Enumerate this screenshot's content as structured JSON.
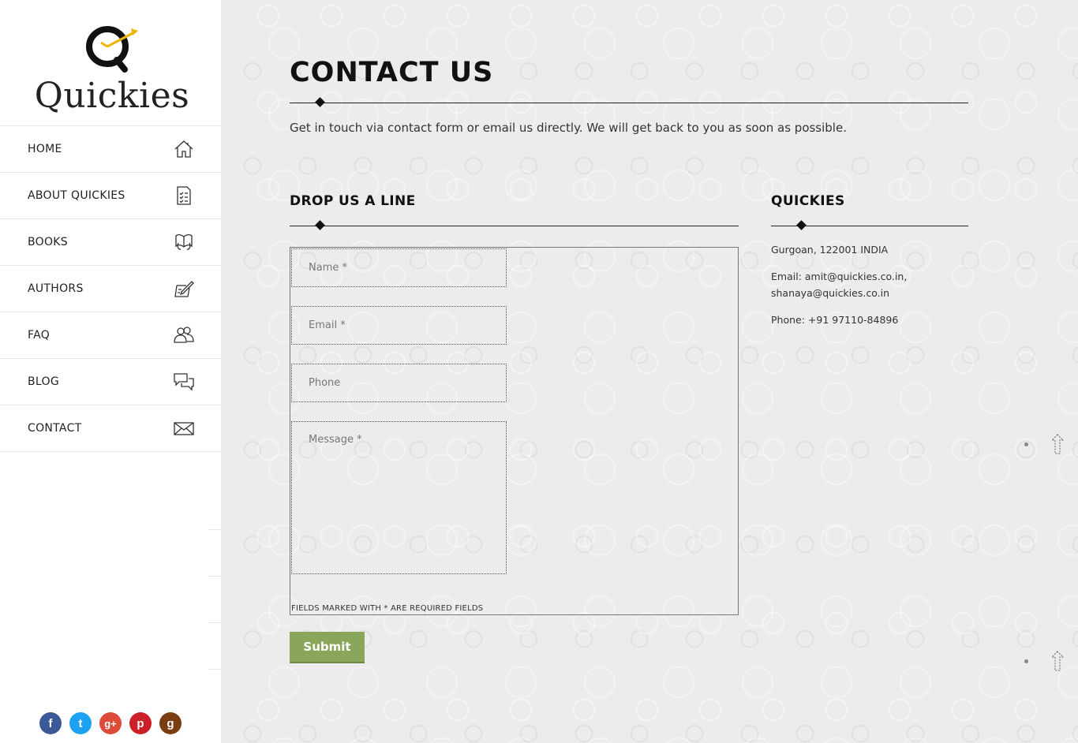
{
  "brand": {
    "name": "Quickies"
  },
  "nav": [
    {
      "label": "HOME",
      "icon": "home-icon"
    },
    {
      "label": "ABOUT QUICKIES",
      "icon": "checklist-icon"
    },
    {
      "label": "BOOKS",
      "icon": "open-book-icon"
    },
    {
      "label": "AUTHORS",
      "icon": "writing-icon"
    },
    {
      "label": "FAQ",
      "icon": "users-icon"
    },
    {
      "label": "BLOG",
      "icon": "chat-icon"
    },
    {
      "label": "CONTACT",
      "icon": "envelope-icon"
    }
  ],
  "social": [
    {
      "icon": "facebook-icon",
      "glyph": "f",
      "color": "#3b5998"
    },
    {
      "icon": "twitter-icon",
      "glyph": "t",
      "color": "#1da1f2"
    },
    {
      "icon": "google-plus-icon",
      "glyph": "g+",
      "color": "#dd4b39"
    },
    {
      "icon": "pinterest-icon",
      "glyph": "p",
      "color": "#cb2027"
    },
    {
      "icon": "goodreads-icon",
      "glyph": "g",
      "color": "#7a3d12"
    }
  ],
  "page": {
    "title": "CONTACT US",
    "intro": "Get in touch via contact form or email us directly. We will get back to you as soon as possible."
  },
  "form": {
    "title": "DROP US A LINE",
    "name_placeholder": "Name *",
    "email_placeholder": "Email *",
    "phone_placeholder": "Phone",
    "message_placeholder": "Message *",
    "required_note": "FIELDS MARKED WITH * ARE REQUIRED FIELDS",
    "submit_label": "Submit"
  },
  "info": {
    "title": "QUICKIES",
    "address": "Gurgoan, 122001 INDIA",
    "email_line1": "Email: amit@quickies.co.in,",
    "email_line2": "shanaya@quickies.co.in",
    "phone": "Phone: +91 97110-84896"
  },
  "colors": {
    "accent": "#8aa65a",
    "logo_gold": "#f0b400"
  }
}
